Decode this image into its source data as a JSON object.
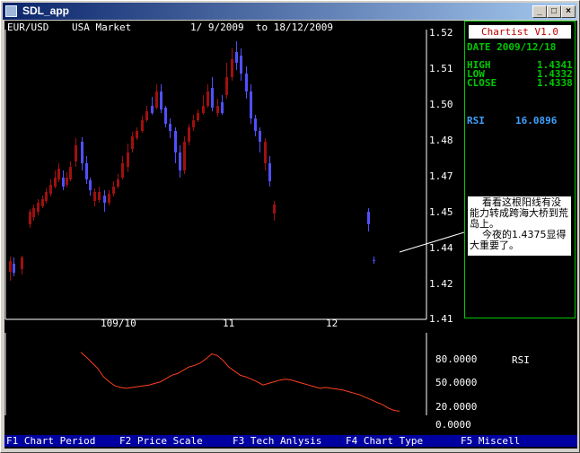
{
  "window": {
    "title": "SDL_app"
  },
  "chart_header": {
    "symbol": "EUR/USD",
    "market": "USA Market",
    "range": "1/ 9/2009  to 18/12/2009"
  },
  "info": {
    "logo": "Chartist V1.0",
    "date": "DATE 2009/12/18",
    "high_label": "HIGH",
    "high": "1.4341",
    "low_label": "LOW",
    "low": "1.4332",
    "close_label": "CLOSE",
    "close": "1.4338",
    "rsi_label": "RSI",
    "rsi": "16.0896"
  },
  "note": {
    "line1": "看看这根阳线有没能力转成跨海大桥到荒岛上。",
    "line2": "今夜的1.4375显得大重要了。"
  },
  "rsi_panel": {
    "label": "RSI"
  },
  "menu": [
    {
      "label": "F1 Chart Period"
    },
    {
      "label": "F2 Price Scale"
    },
    {
      "label": "F3 Tech Anlysis"
    },
    {
      "label": "F4 Chart Type"
    },
    {
      "label": "F5 Miscell"
    }
  ],
  "chart_data": {
    "type": "candlestick",
    "price_axis": {
      "ticks": [
        "1.52",
        "1.51",
        "1.50",
        "1.48",
        "1.47",
        "1.45",
        "1.44",
        "1.42",
        "1.41"
      ]
    },
    "x_tick_labels": [
      "109/10",
      "11",
      "12"
    ],
    "rsi_axis": {
      "ticks": [
        "80.0000",
        "50.0000",
        "20.0000",
        "0.0000"
      ]
    },
    "candles": [
      {
        "o": 1.4275,
        "c": 1.4335,
        "h": 1.436,
        "l": 1.4225,
        "up": false
      },
      {
        "o": 1.432,
        "c": 1.427,
        "h": 1.4355,
        "l": 1.425,
        "up": true
      },
      {
        "o": 1.429,
        "c": 1.4355,
        "h": 1.4365,
        "l": 1.426,
        "up": false
      },
      {
        "o": 1.447,
        "c": 1.451,
        "h": 1.4525,
        "l": 1.446,
        "up": false
      },
      {
        "o": 1.449,
        "c": 1.453,
        "h": 1.455,
        "l": 1.448,
        "up": false
      },
      {
        "o": 1.451,
        "c": 1.456,
        "h": 1.458,
        "l": 1.4495,
        "up": false
      },
      {
        "o": 1.454,
        "c": 1.458,
        "h": 1.46,
        "l": 1.453,
        "up": false
      },
      {
        "o": 1.457,
        "c": 1.462,
        "h": 1.464,
        "l": 1.4555,
        "up": false
      },
      {
        "o": 1.461,
        "c": 1.466,
        "h": 1.469,
        "l": 1.4595,
        "up": false
      },
      {
        "o": 1.465,
        "c": 1.47,
        "h": 1.472,
        "l": 1.464,
        "up": false
      },
      {
        "o": 1.469,
        "c": 1.4725,
        "h": 1.474,
        "l": 1.4675,
        "up": false
      },
      {
        "o": 1.47,
        "c": 1.465,
        "h": 1.472,
        "l": 1.463,
        "up": true
      },
      {
        "o": 1.466,
        "c": 1.47,
        "h": 1.4715,
        "l": 1.4645,
        "up": false
      },
      {
        "o": 1.469,
        "c": 1.473,
        "h": 1.4745,
        "l": 1.468,
        "up": false
      },
      {
        "o": 1.4745,
        "c": 1.479,
        "h": 1.482,
        "l": 1.473,
        "up": false
      },
      {
        "o": 1.48,
        "c": 1.474,
        "h": 1.4825,
        "l": 1.472,
        "up": true
      },
      {
        "o": 1.474,
        "c": 1.469,
        "h": 1.476,
        "l": 1.4665,
        "up": true
      },
      {
        "o": 1.4685,
        "c": 1.463,
        "h": 1.47,
        "l": 1.46,
        "up": true
      },
      {
        "o": 1.462,
        "c": 1.457,
        "h": 1.464,
        "l": 1.454,
        "up": false
      },
      {
        "o": 1.4575,
        "c": 1.462,
        "h": 1.465,
        "l": 1.456,
        "up": false
      },
      {
        "o": 1.46,
        "c": 1.456,
        "h": 1.463,
        "l": 1.451,
        "up": true
      },
      {
        "o": 1.456,
        "c": 1.461,
        "h": 1.463,
        "l": 1.4545,
        "up": false
      },
      {
        "o": 1.461,
        "c": 1.465,
        "h": 1.468,
        "l": 1.4595,
        "up": false
      },
      {
        "o": 1.465,
        "c": 1.469,
        "h": 1.471,
        "l": 1.464,
        "up": false
      },
      {
        "o": 1.47,
        "c": 1.474,
        "h": 1.476,
        "l": 1.469,
        "up": false
      },
      {
        "o": 1.473,
        "c": 1.477,
        "h": 1.4795,
        "l": 1.4715,
        "up": false
      },
      {
        "o": 1.478,
        "c": 1.483,
        "h": 1.4855,
        "l": 1.477,
        "up": false
      },
      {
        "o": 1.482,
        "c": 1.486,
        "h": 1.488,
        "l": 1.481,
        "up": false
      },
      {
        "o": 1.486,
        "c": 1.492,
        "h": 1.4945,
        "l": 1.485,
        "up": false
      },
      {
        "o": 1.492,
        "c": 1.497,
        "h": 1.5,
        "l": 1.491,
        "up": false
      },
      {
        "o": 1.496,
        "c": 1.5,
        "h": 1.5025,
        "l": 1.495,
        "up": true
      },
      {
        "o": 1.499,
        "c": 1.504,
        "h": 1.506,
        "l": 1.498,
        "up": false
      },
      {
        "o": 1.504,
        "c": 1.498,
        "h": 1.506,
        "l": 1.496,
        "up": true
      },
      {
        "o": 1.499,
        "c": 1.49,
        "h": 1.5,
        "l": 1.488,
        "up": true
      },
      {
        "o": 1.49,
        "c": 1.486,
        "h": 1.493,
        "l": 1.482,
        "up": true
      },
      {
        "o": 1.486,
        "c": 1.477,
        "h": 1.488,
        "l": 1.474,
        "up": true
      },
      {
        "o": 1.477,
        "c": 1.472,
        "h": 1.479,
        "l": 1.47,
        "up": true
      },
      {
        "o": 1.472,
        "c": 1.48,
        "h": 1.483,
        "l": 1.471,
        "up": false
      },
      {
        "o": 1.48,
        "c": 1.488,
        "h": 1.49,
        "l": 1.479,
        "up": false
      },
      {
        "o": 1.488,
        "c": 1.492,
        "h": 1.495,
        "l": 1.486,
        "up": false
      },
      {
        "o": 1.492,
        "c": 1.496,
        "h": 1.498,
        "l": 1.491,
        "up": false
      },
      {
        "o": 1.496,
        "c": 1.5,
        "h": 1.503,
        "l": 1.495,
        "up": false
      },
      {
        "o": 1.5,
        "c": 1.504,
        "h": 1.506,
        "l": 1.499,
        "up": false
      },
      {
        "o": 1.505,
        "c": 1.499,
        "h": 1.508,
        "l": 1.497,
        "up": true
      },
      {
        "o": 1.5,
        "c": 1.496,
        "h": 1.502,
        "l": 1.494,
        "up": false
      },
      {
        "o": 1.496,
        "c": 1.501,
        "h": 1.503,
        "l": 1.495,
        "up": true
      },
      {
        "o": 1.503,
        "c": 1.508,
        "h": 1.512,
        "l": 1.502,
        "up": false
      },
      {
        "o": 1.508,
        "c": 1.513,
        "h": 1.516,
        "l": 1.507,
        "up": false
      },
      {
        "o": 1.512,
        "c": 1.515,
        "h": 1.518,
        "l": 1.51,
        "up": true
      },
      {
        "o": 1.514,
        "c": 1.509,
        "h": 1.516,
        "l": 1.507,
        "up": true
      },
      {
        "o": 1.509,
        "c": 1.504,
        "h": 1.511,
        "l": 1.502,
        "up": true
      },
      {
        "o": 1.504,
        "c": 1.493,
        "h": 1.506,
        "l": 1.49,
        "up": true
      },
      {
        "o": 1.493,
        "c": 1.486,
        "h": 1.495,
        "l": 1.483,
        "up": true
      },
      {
        "o": 1.486,
        "c": 1.48,
        "h": 1.488,
        "l": 1.477,
        "up": true
      },
      {
        "o": 1.48,
        "c": 1.474,
        "h": 1.482,
        "l": 1.472,
        "up": false
      },
      {
        "o": 1.474,
        "c": 1.468,
        "h": 1.476,
        "l": 1.465,
        "up": true
      },
      {
        "o": 1.455,
        "c": 1.45,
        "h": 1.457,
        "l": 1.448,
        "up": false
      },
      {
        "o": 1.451,
        "c": 1.447,
        "h": 1.453,
        "l": 1.445,
        "up": true
      },
      {
        "o": 1.4341,
        "c": 1.4338,
        "h": 1.436,
        "l": 1.432,
        "up": true
      }
    ],
    "rsi_values": [
      88,
      82,
      75,
      68,
      58,
      52,
      47,
      45,
      44,
      45,
      46,
      47,
      48,
      50,
      52,
      56,
      60,
      62,
      66,
      70,
      72,
      75,
      80,
      86,
      84,
      78,
      70,
      65,
      60,
      58,
      55,
      52,
      48,
      50,
      52,
      54,
      55,
      54,
      52,
      50,
      48,
      46,
      44,
      45,
      44,
      43,
      42,
      40,
      38,
      36,
      33,
      30,
      27,
      24,
      20,
      17,
      16
    ]
  }
}
